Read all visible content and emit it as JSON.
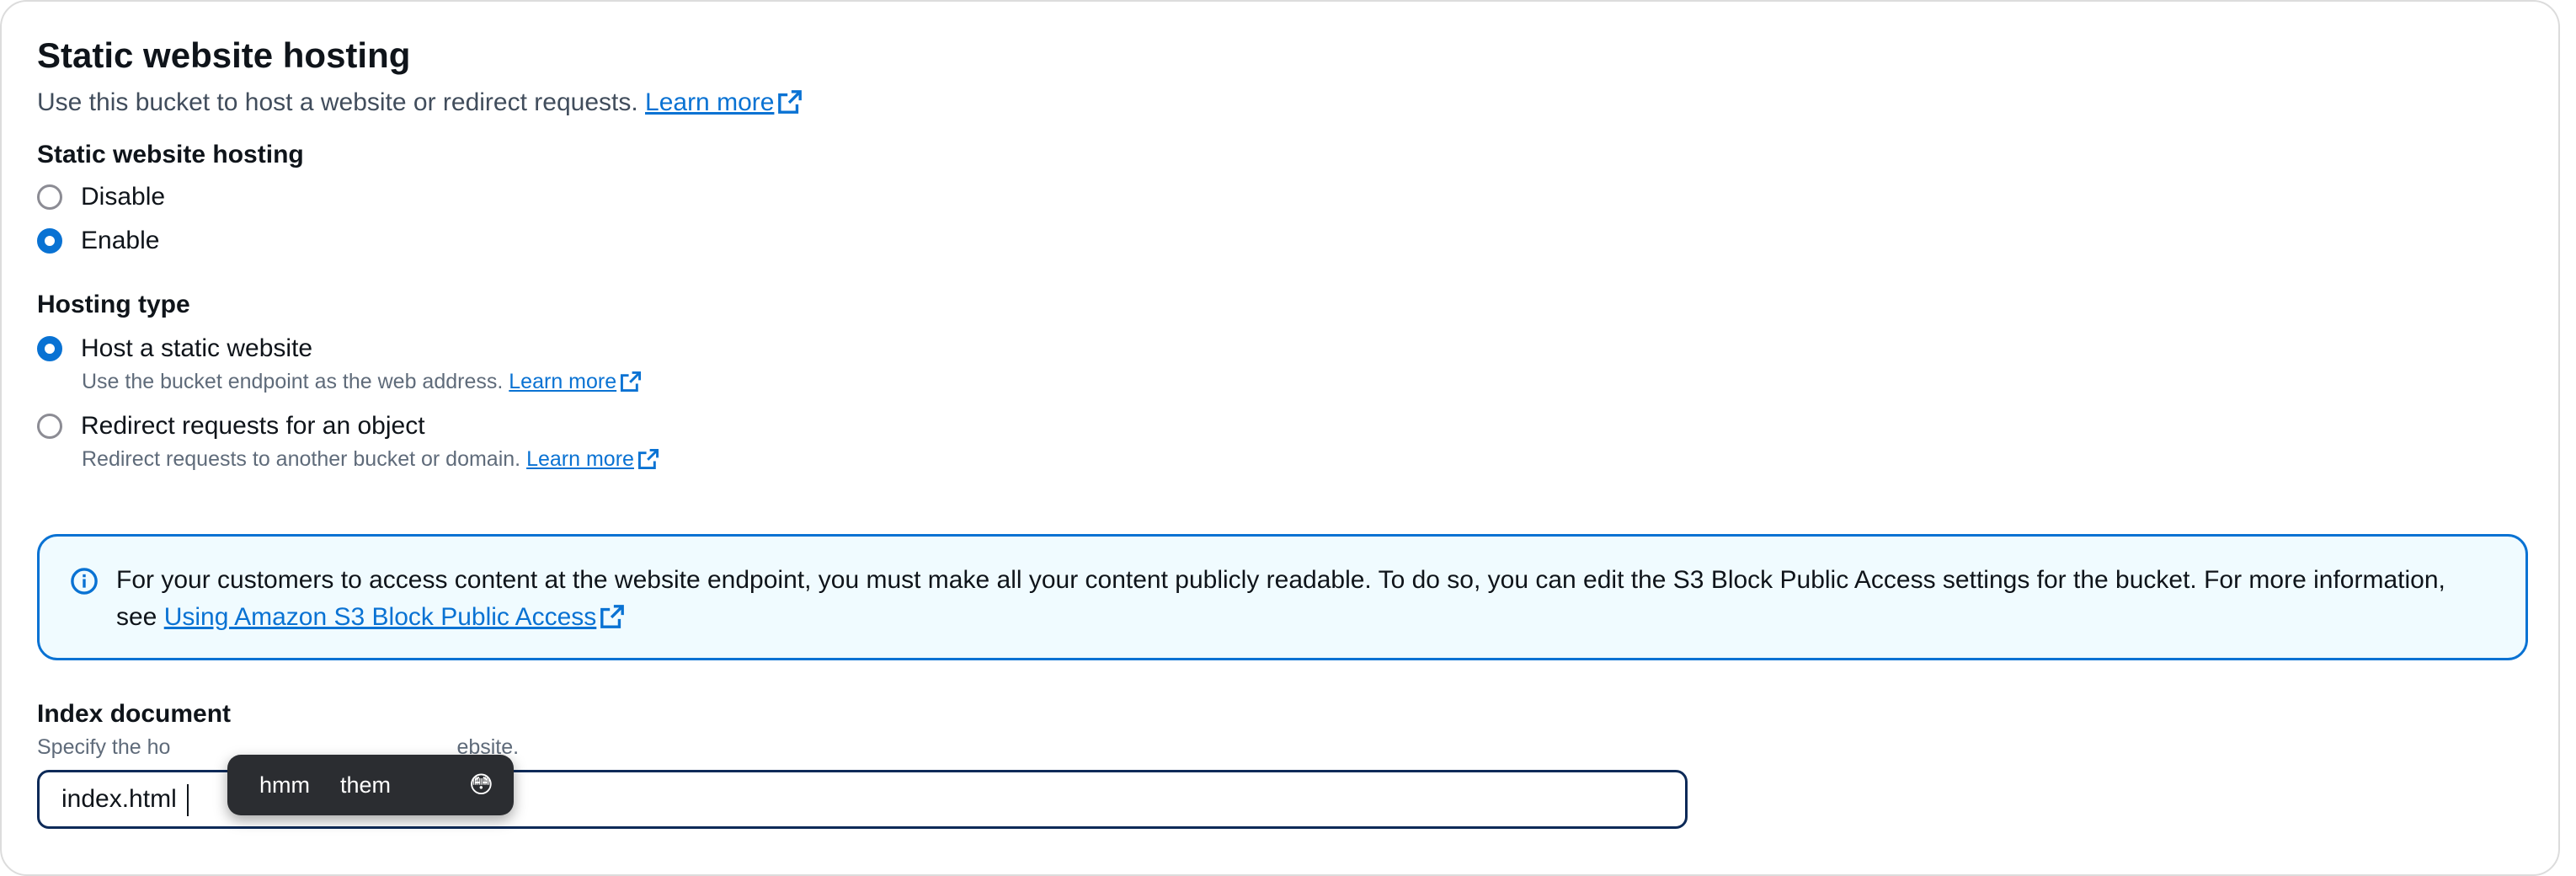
{
  "header": {
    "title": "Static website hosting",
    "description": "Use this bucket to host a website or redirect requests.",
    "learn_more": "Learn more"
  },
  "hosting_toggle": {
    "label": "Static website hosting",
    "options": [
      {
        "label": "Disable",
        "checked": false
      },
      {
        "label": "Enable",
        "checked": true
      }
    ]
  },
  "hosting_type": {
    "label": "Hosting type",
    "options": [
      {
        "label": "Host a static website",
        "description": "Use the bucket endpoint as the web address.",
        "learn_more": "Learn more",
        "checked": true
      },
      {
        "label": "Redirect requests for an object",
        "description": "Redirect requests to another bucket or domain.",
        "learn_more": "Learn more",
        "checked": false
      }
    ]
  },
  "alert": {
    "text": "For your customers to access content at the website endpoint, you must make all your content publicly readable. To do so, you can edit the S3 Block Public Access settings for the bucket. For more information, see",
    "link": "Using Amazon S3 Block Public Access"
  },
  "index_document": {
    "label": "Index document",
    "description_prefix": "Specify the ho",
    "description_suffix": "ebsite.",
    "value": "index.html"
  },
  "suggestions": {
    "items": [
      "hmm",
      "them"
    ],
    "emoji": "😳"
  },
  "colors": {
    "link": "#0972d3",
    "alert_border": "#0972d3",
    "alert_bg": "#f0fbff",
    "input_border": "#0d2a58",
    "suggestion_bg": "#2b2d31"
  }
}
